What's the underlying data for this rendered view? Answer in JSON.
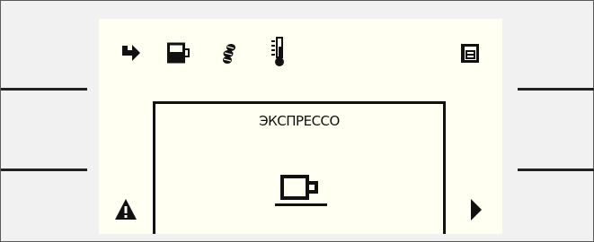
{
  "screen": {
    "background": "#fffff2",
    "status_icons": [
      "rinse-arrow-icon",
      "grounds-container-icon",
      "beans-icon",
      "thermometer-icon",
      "tray-icon"
    ],
    "product": {
      "name": "ЭКСПРЕССО",
      "icon": "espresso-cup-icon"
    },
    "warning_icon": "warning-triangle-icon",
    "next_icon": "next-arrow-icon"
  }
}
